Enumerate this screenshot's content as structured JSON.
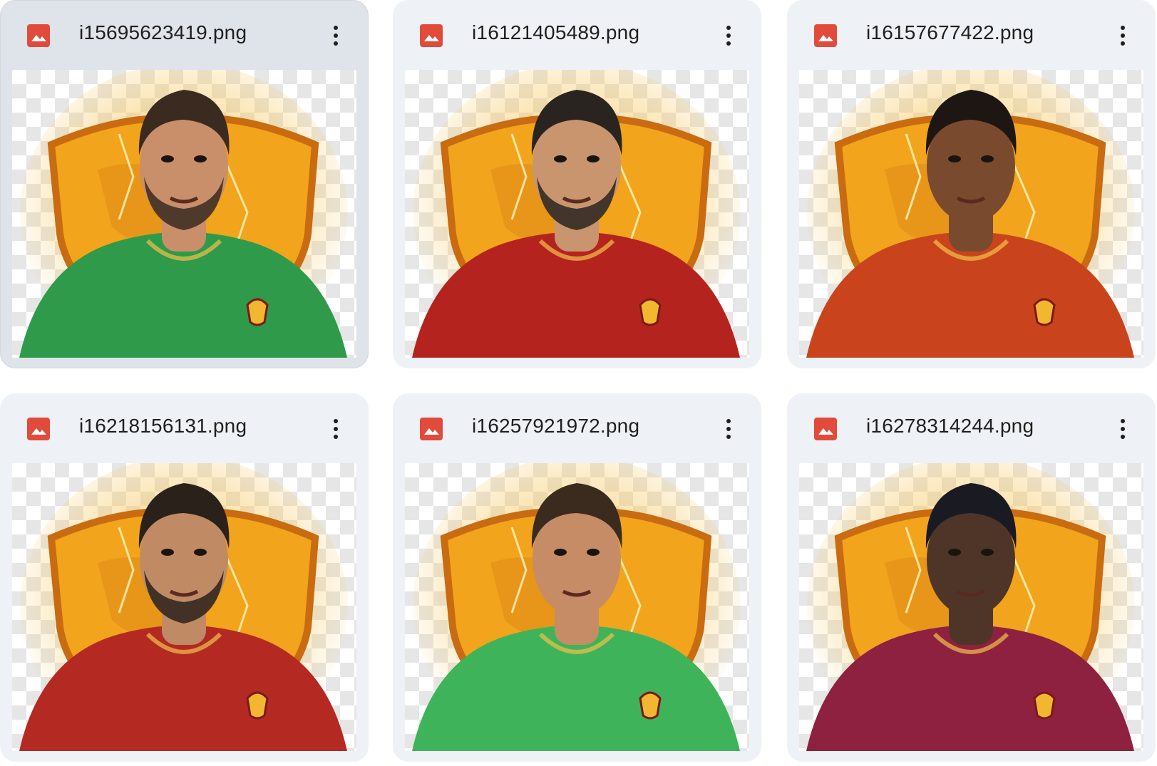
{
  "files": [
    {
      "name": "i15695623419.png",
      "selected": true,
      "icon": "image-file-icon",
      "jersey": "#2f9a4a",
      "hair": "#3a2a20",
      "skin": "#c98f6a",
      "beard": true
    },
    {
      "name": "i16121405489.png",
      "selected": false,
      "icon": "image-file-icon",
      "jersey": "#b5231f",
      "hair": "#2a2420",
      "skin": "#c9956e",
      "beard": true
    },
    {
      "name": "i16157677422.png",
      "selected": false,
      "icon": "image-file-icon",
      "jersey": "#c9441c",
      "hair": "#1d1612",
      "skin": "#7a4a2e",
      "beard": false
    },
    {
      "name": "i16218156131.png",
      "selected": false,
      "icon": "image-file-icon",
      "jersey": "#b42a22",
      "hair": "#2a211b",
      "skin": "#c08a64",
      "beard": true
    },
    {
      "name": "i16257921972.png",
      "selected": false,
      "icon": "image-file-icon",
      "jersey": "#3fb35a",
      "hair": "#3b2a1e",
      "skin": "#c58c66",
      "beard": false
    },
    {
      "name": "i16278314244.png",
      "selected": false,
      "icon": "image-file-icon",
      "jersey": "#8e2140",
      "hair": "#1a1a22",
      "skin": "#4e3528",
      "beard": false
    }
  ],
  "menu_icon": "more-vert-icon",
  "colors": {
    "crest": "#f2a41c",
    "crest_edge": "#c96b10",
    "glow": "#f7c860"
  }
}
